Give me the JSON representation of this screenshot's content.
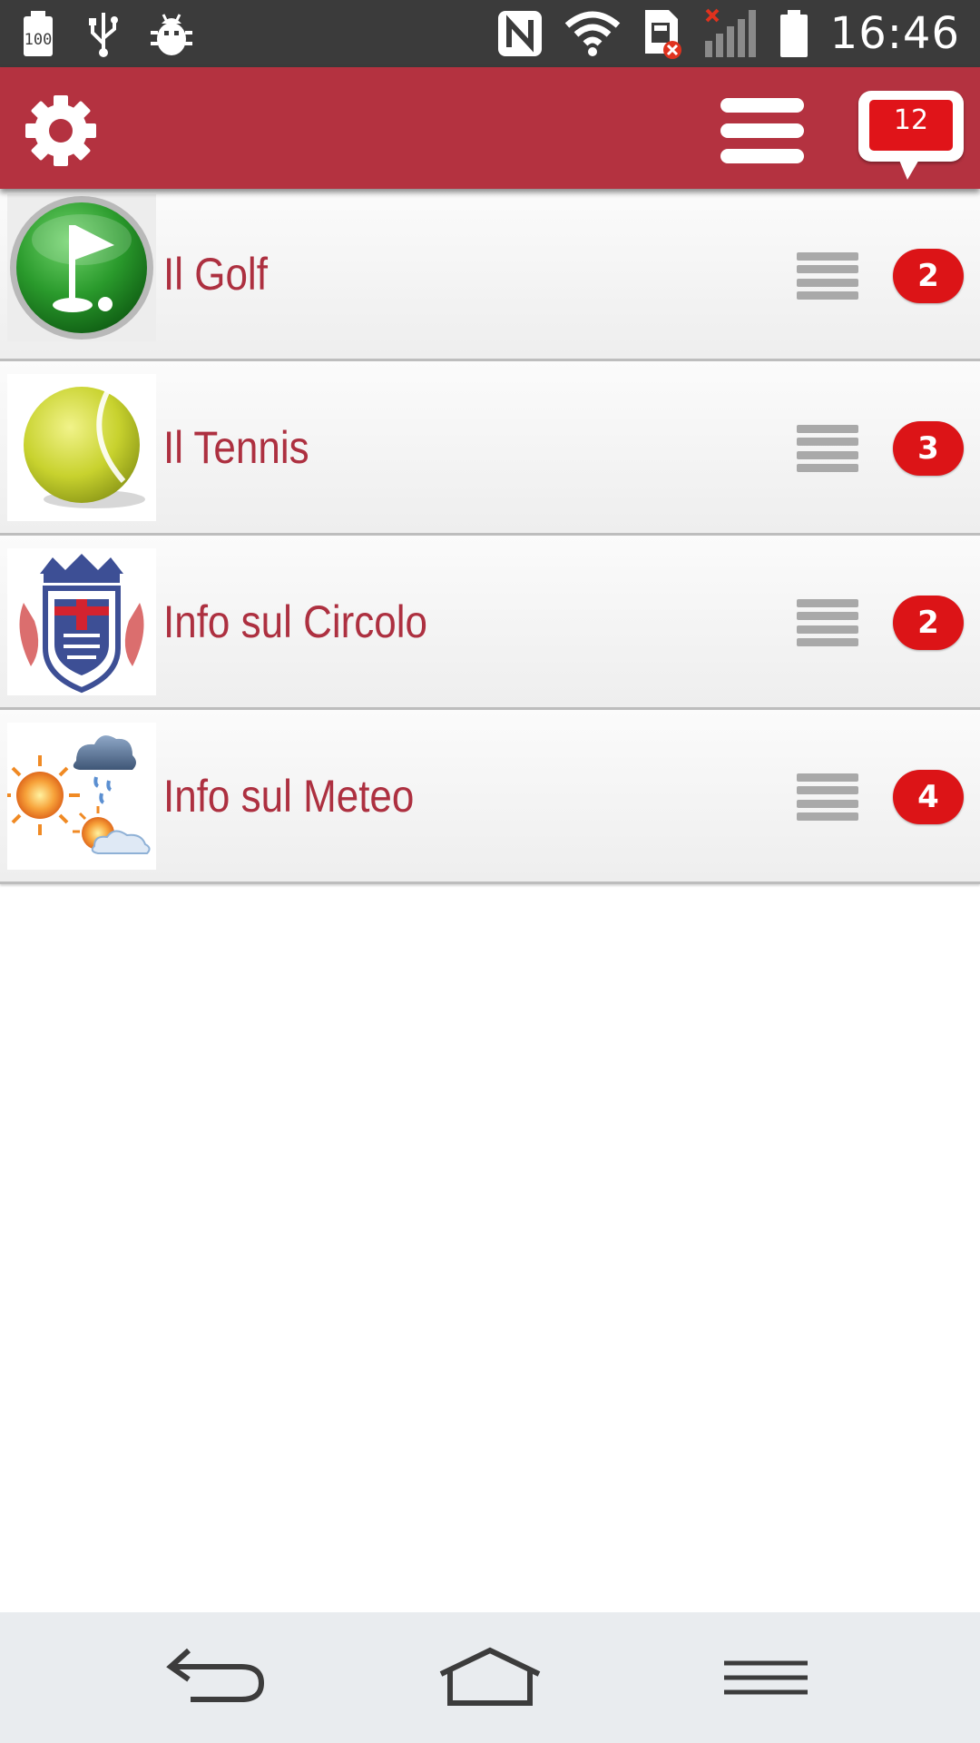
{
  "status_bar": {
    "time": "16:46",
    "battery_indicator_text": "100",
    "icons": [
      "battery-saver-icon",
      "usb-icon",
      "debug-bug-icon",
      "nfc-icon",
      "wifi-icon",
      "sim-error-icon",
      "signal-off-icon",
      "battery-icon"
    ]
  },
  "app_bar": {
    "settings_icon": "gear-icon",
    "menu_icon": "hamburger-menu-icon",
    "messages_count": "12",
    "accent_color": "#b43240"
  },
  "list": {
    "items": [
      {
        "title": "Il Golf",
        "badge": "2",
        "icon": "golf-flag-icon"
      },
      {
        "title": "Il Tennis",
        "badge": "3",
        "icon": "tennis-ball-icon"
      },
      {
        "title": "Info sul Circolo",
        "badge": "2",
        "icon": "club-crest-icon"
      },
      {
        "title": "Info sul Meteo",
        "badge": "4",
        "icon": "weather-icon"
      }
    ],
    "title_color": "#ad3040",
    "badge_color": "#dc1417"
  },
  "nav_bar": {
    "icons": [
      "back-icon",
      "home-icon",
      "recent-menu-icon"
    ]
  }
}
